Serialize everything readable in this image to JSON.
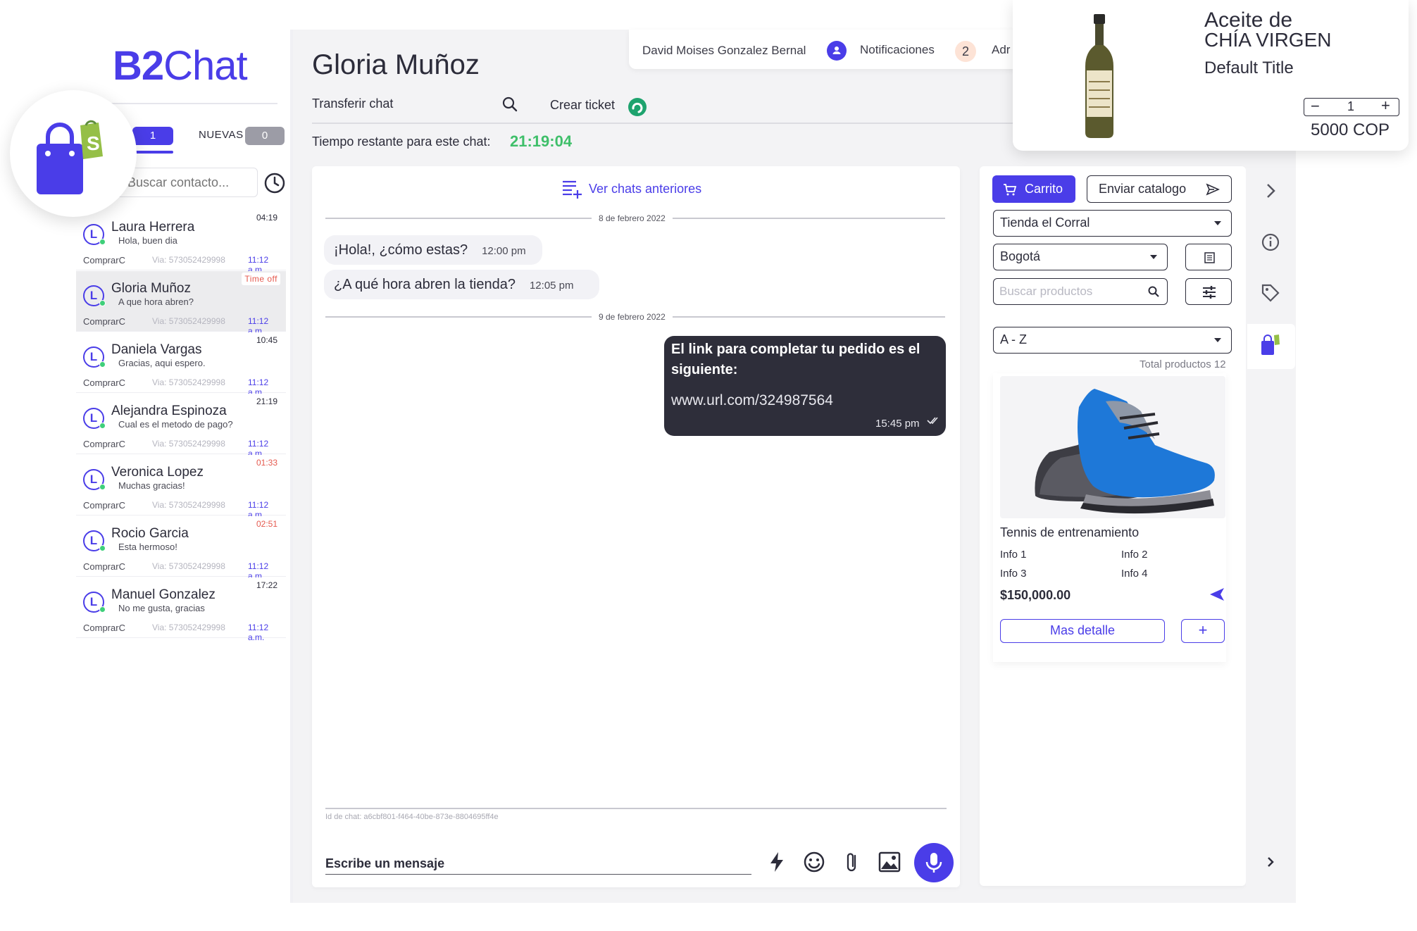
{
  "app": {
    "logo_b": "B2",
    "logo_rest": "Chat",
    "brand_color": "#4a3de8"
  },
  "sidebar": {
    "tab_mine_count": "1",
    "tab_new_label": "NUEVAS",
    "tab_new_count": "0",
    "search_placeholder": "Buscar contacto...",
    "contacts": [
      {
        "initial": "L",
        "name": "Laura Herrera",
        "message": "Hola, buen dia",
        "time": "04:19",
        "time_style": "normal",
        "channel": "ComprarC",
        "via": "Via: 573052429998",
        "at": "11:12 a.m."
      },
      {
        "initial": "L",
        "name": "Gloria Muñoz",
        "message": "A que hora abren?",
        "time": "Time off",
        "time_style": "timeoff",
        "channel": "ComprarC",
        "via": "Via: 573052429998",
        "at": "11:12 a.m.",
        "active": true
      },
      {
        "initial": "L",
        "name": "Daniela Vargas",
        "message": "Gracias, aqui espero.",
        "time": "10:45",
        "time_style": "normal",
        "channel": "ComprarC",
        "via": "Via: 573052429998",
        "at": "11:12 a.m."
      },
      {
        "initial": "L",
        "name": "Alejandra Espinoza",
        "message": "Cual es el metodo de pago?",
        "time": "21:19",
        "time_style": "normal",
        "channel": "ComprarC",
        "via": "Via: 573052429998",
        "at": "11:12 a.m."
      },
      {
        "initial": "L",
        "name": "Veronica Lopez",
        "message": "Muchas gracias!",
        "time": "01:33",
        "time_style": "alert",
        "channel": "ComprarC",
        "via": "Via: 573052429998",
        "at": "11:12 a.m."
      },
      {
        "initial": "L",
        "name": "Rocio Garcia",
        "message": "Esta hermoso!",
        "time": "02:51",
        "time_style": "alert",
        "channel": "ComprarC",
        "via": "Via: 573052429998",
        "at": "11:12 a.m."
      },
      {
        "initial": "L",
        "name": "Manuel Gonzalez",
        "message": "No me gusta, gracias",
        "time": "17:22",
        "time_style": "normal",
        "channel": "ComprarC",
        "via": "Via: 573052429998",
        "at": "11:12 a.m."
      }
    ]
  },
  "header": {
    "contact_name": "Gloria Muñoz",
    "transfer_label": "Transferir chat",
    "ticket_label": "Crear ticket",
    "remaining_label": "Tiempo restante para este chat:",
    "remaining_value": "21:19:04"
  },
  "user_bar": {
    "user_name": "David Moises Gonzalez Bernal",
    "notifications_label": "Notificaciones",
    "notifications_count": "2",
    "admin_label": "Adr"
  },
  "chat": {
    "previous_chats_label": "Ver chats anteriores",
    "date_1": "8 de febrero 2022",
    "date_2": "9 de febrero 2022",
    "messages_in": [
      {
        "text": "¡Hola!, ¿cómo estas?",
        "time": "12:00 pm"
      },
      {
        "text": "¿A qué hora abren la tienda?",
        "time": "12:05 pm"
      }
    ],
    "message_out": {
      "text": "El link para completar tu pedido es el siguiente:",
      "link": "www.url.com/324987564",
      "time": "15:45 pm"
    },
    "chat_id_label": "Id de chat: a6cbf801-f464-40be-873e-8804695ff4e",
    "input_placeholder": "Escribe un mensaje"
  },
  "catalog": {
    "cart_label": "Carrito",
    "send_catalog_label": "Enviar catalogo",
    "store_select": "Tienda el Corral",
    "city_select": "Bogotá",
    "search_placeholder": "Buscar productos",
    "sort_select": "A - Z",
    "total_products": "Total productos 12",
    "product": {
      "name": "Tennis de entrenamiento",
      "info_1": "Info 1",
      "info_2": "Info 2",
      "info_3": "Info 3",
      "info_4": "Info 4",
      "price": "$150,000.00",
      "more_detail_label": "Mas detalle",
      "add_label": "+"
    }
  },
  "float_card": {
    "title_line_1": "Aceite de",
    "title_line_2": "CHÍA VIRGEN",
    "subtitle": "Default Title",
    "qty_minus": "−",
    "qty_value": "1",
    "qty_plus": "+",
    "price": "5000 COP"
  }
}
